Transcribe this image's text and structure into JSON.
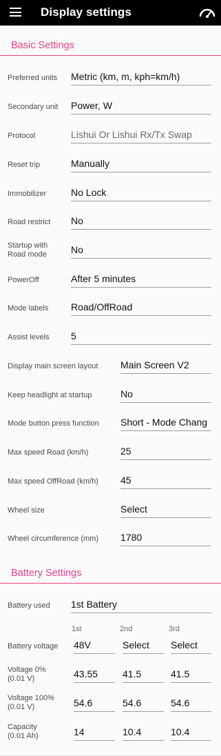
{
  "app": {
    "title": "Display settings",
    "menu_icon": "hamburger-menu-icon",
    "action_icon": "speedometer-icon",
    "accent_color": "#e8438a",
    "appbar_color": "#000000"
  },
  "basic": {
    "title": "Basic Settings",
    "preferred_units": {
      "label": "Preferred units",
      "value": "Metric (km, m, kph=km/h)"
    },
    "secondary_unit": {
      "label": "Secondary unit",
      "value": "Power, W"
    },
    "protocol": {
      "label": "Protocol",
      "value": "Lishui Or  Lishui Rx/Tx Swap"
    },
    "reset_trip": {
      "label": "Reset trip",
      "value": "Manually"
    },
    "immobilizer": {
      "label": "Immobilizer",
      "value": "No Lock"
    },
    "road_restrict": {
      "label": "Road restrict",
      "value": "No"
    },
    "startup_road_mode": {
      "label_line1": "Startup with",
      "label_line2": "Road mode",
      "value": "No"
    },
    "power_off": {
      "label": "PowerOff",
      "value": "After 5 minutes"
    },
    "mode_labels": {
      "label": "Mode labels",
      "value": "Road/OffRoad"
    },
    "assist_levels": {
      "label": "Assist levels",
      "value": "5"
    },
    "main_layout": {
      "label": "Display main screen layout",
      "value": "Main Screen V2"
    },
    "headlight": {
      "label": "Keep headlight at startup",
      "value": "No"
    },
    "mode_button": {
      "label": "Mode button press function",
      "value": "Short - Mode Chang"
    },
    "max_speed_road": {
      "label": "Max speed Road (km/h)",
      "value": "25"
    },
    "max_speed_offroad": {
      "label": "Max speed OffRoad (km/h)",
      "value": "45"
    },
    "wheel_size": {
      "label": "Wheel size",
      "value": "Select"
    },
    "wheel_circumference": {
      "label": "Wheel circumference (mm)",
      "value": "1780"
    }
  },
  "battery": {
    "title": "Battery Settings",
    "used": {
      "label": "Battery used",
      "value": "1st Battery"
    },
    "columns": [
      "1st",
      "2nd",
      "3rd"
    ],
    "voltage": {
      "label": "Battery voltage",
      "values": [
        "48V",
        "Select",
        "Select"
      ]
    },
    "voltage_0": {
      "label_line1": "Voltage 0%",
      "label_line2": "(0.01 V)",
      "values": [
        "43.55",
        "41.5",
        "41.5"
      ]
    },
    "voltage_100": {
      "label_line1": "Voltage 100%",
      "label_line2": "(0.01 V)",
      "values": [
        "54.6",
        "54.6",
        "54.6"
      ]
    },
    "capacity": {
      "label_line1": "Capacity",
      "label_line2": "(0.01 Ah)",
      "values": [
        "14",
        "10.4",
        "10.4"
      ]
    }
  }
}
